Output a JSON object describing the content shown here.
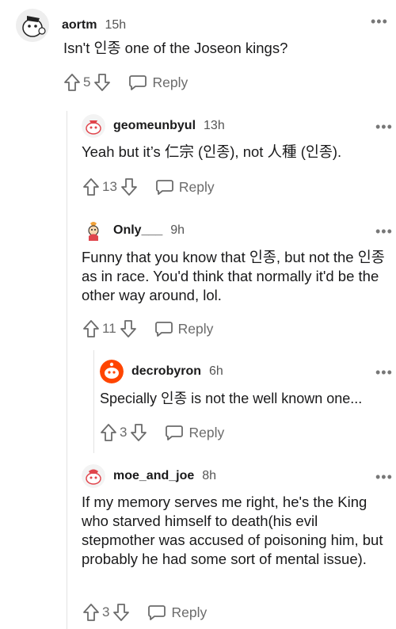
{
  "colors": {
    "text": "#1a1a1b",
    "meta": "#555555",
    "action": "#6b6b6b",
    "line": "#e3e3e3",
    "avatar_orange": "#ff4500"
  },
  "comments": [
    {
      "user": "aortm",
      "time": "15h",
      "text": "Isn't 인종 one of the Joseon kings?",
      "votes": "5",
      "reply": "Reply"
    },
    {
      "user": "geomeunbyul",
      "time": "13h",
      "text": "Yeah but it’s 仁宗 (인종), not 人種 (인종).",
      "votes": "13",
      "reply": "Reply"
    },
    {
      "user": "Only___",
      "time": "9h",
      "text": "Funny that you know that 인종, but not the 인종 as in race. You'd think that normally it'd be the other way around, lol.",
      "votes": "11",
      "reply": "Reply"
    },
    {
      "user": "decrobyron",
      "time": "6h",
      "text": "Specially 인종 is not the well known one...",
      "votes": "3",
      "reply": "Reply"
    },
    {
      "user": "moe_and_joe",
      "time": "8h",
      "text": "If my memory serves me right, he's the King who starved himself to death(his evil stepmother was accused of poisoning him, but probably he had some sort of mental issue).",
      "votes": "3",
      "reply": "Reply"
    }
  ],
  "icons": {
    "upvote": "arrow-up-icon",
    "downvote": "arrow-down-icon",
    "reply": "speech-bubble-icon",
    "more": "more-dots-icon"
  }
}
